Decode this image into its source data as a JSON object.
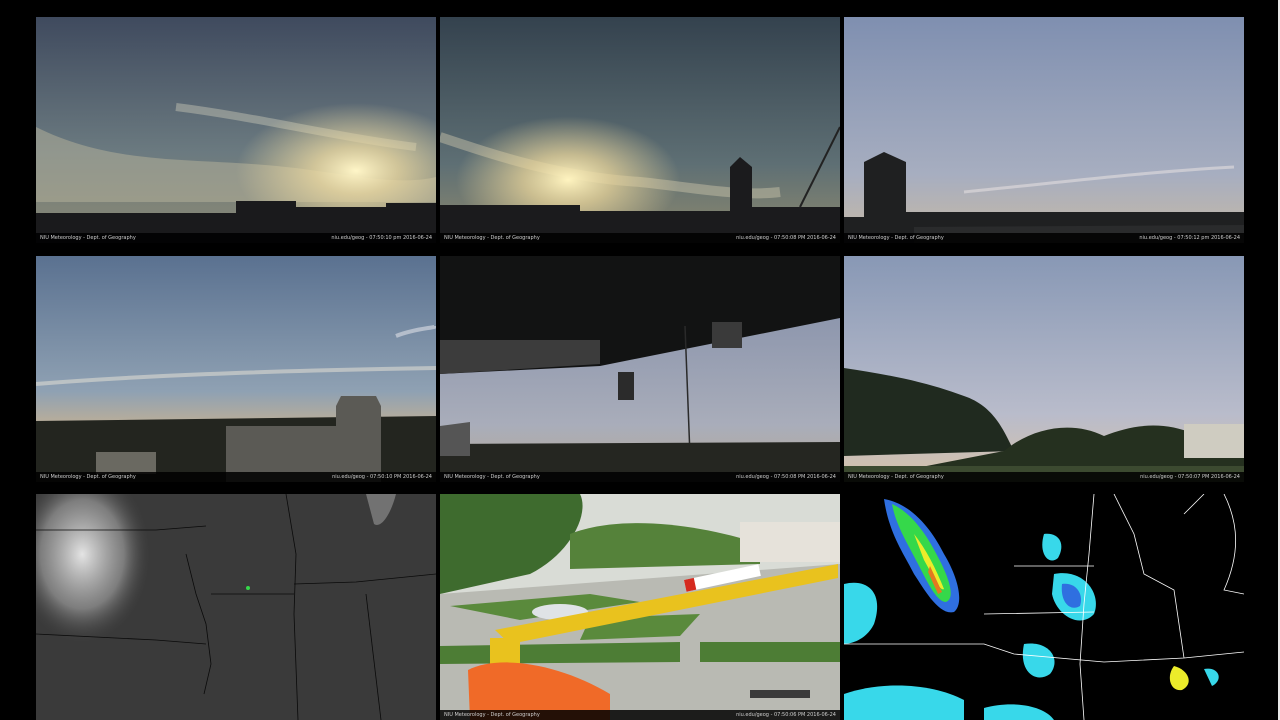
{
  "panels": [
    {
      "caption_left": "NIU Meteorology - Dept. of Geography",
      "caption_right": "niu.edu/geog - 07:50:10 pm 2016-06-24"
    },
    {
      "caption_left": "NIU Meteorology - Dept. of Geography",
      "caption_right": "niu.edu/geog - 07:50:08 PM 2016-06-24"
    },
    {
      "caption_left": "NIU Meteorology - Dept. of Geography",
      "caption_right": "niu.edu/geog - 07:50:12 pm 2016-06-24"
    },
    {
      "caption_left": "NIU Meteorology - Dept. of Geography",
      "caption_right": "niu.edu/geog - 07:50:10 PM 2016-06-24"
    },
    {
      "caption_left": "NIU Meteorology - Dept. of Geography",
      "caption_right": "niu.edu/geog - 07:50:08 PM 2016-06-24"
    },
    {
      "caption_left": "NIU Meteorology - Dept. of Geography",
      "caption_right": "niu.edu/geog - 07:50:07 PM 2016-06-24"
    },
    {
      "caption_left": "",
      "caption_right": ""
    },
    {
      "caption_left": "NIU Meteorology - Dept. of Geography",
      "caption_right": "niu.edu/geog - 07:50:06 PM 2016-06-24"
    },
    {
      "caption_left": "",
      "caption_right": ""
    }
  ],
  "colors": {
    "background": "#000000",
    "radar_green": "#35d84a",
    "radar_cyan": "#38d8ea",
    "radar_blue": "#2f6fe0",
    "radar_yellow": "#ecec2a",
    "lift_yellow": "#e9c21e",
    "lift_orange": "#f06a28"
  }
}
